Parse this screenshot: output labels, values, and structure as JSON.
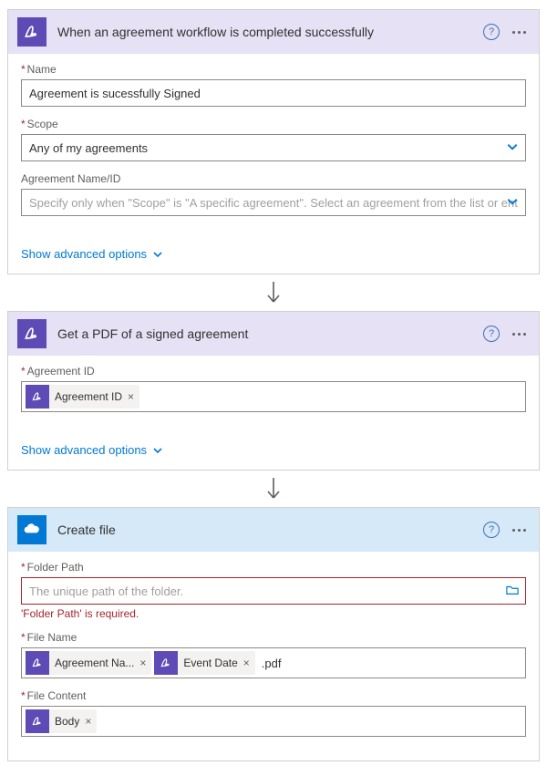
{
  "step1": {
    "title": "When an agreement workflow is completed successfully",
    "fields": {
      "name": {
        "label": "Name",
        "value": "Agreement is sucessfully Signed"
      },
      "scope": {
        "label": "Scope",
        "value": "Any of my agreements"
      },
      "agreement": {
        "label": "Agreement Name/ID",
        "placeholder": "Specify only when \"Scope\" is \"A specific agreement\". Select an agreement from the list or enter th"
      }
    },
    "advanced": "Show advanced options"
  },
  "step2": {
    "title": "Get a PDF of a signed agreement",
    "fields": {
      "agreementId": {
        "label": "Agreement ID",
        "token": "Agreement ID"
      }
    },
    "advanced": "Show advanced options"
  },
  "step3": {
    "title": "Create file",
    "fields": {
      "folderPath": {
        "label": "Folder Path",
        "placeholder": "The unique path of the folder.",
        "error": "'Folder Path' is required."
      },
      "fileName": {
        "label": "File Name",
        "token1": "Agreement Na...",
        "token2": "Event Date",
        "suffix": ".pdf"
      },
      "fileContent": {
        "label": "File Content",
        "token": "Body"
      }
    }
  }
}
